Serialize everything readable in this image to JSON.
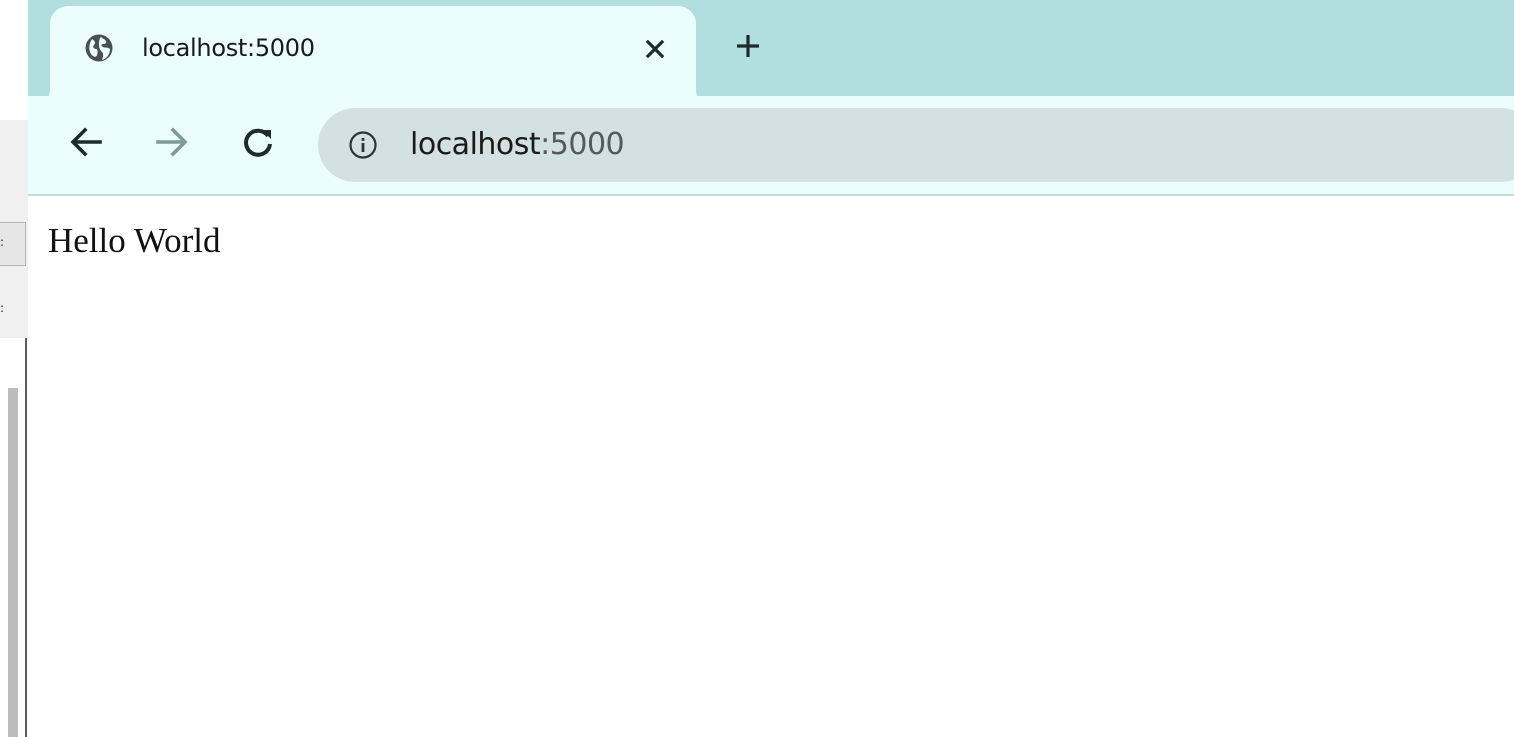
{
  "tab": {
    "title": "localhost:5000",
    "icon": "globe-icon",
    "close_icon": "close-icon"
  },
  "new_tab_icon": "plus-icon",
  "toolbar": {
    "back_icon": "arrow-left-icon",
    "forward_icon": "arrow-right-icon",
    "reload_icon": "reload-icon",
    "info_icon": "info-icon",
    "url_host": "localhost",
    "url_port": ":5000"
  },
  "page": {
    "body_text": "Hello World"
  },
  "colors": {
    "tabstrip": "#b1dfdf",
    "active_tab": "#ecfdfd",
    "omnibox": "#d3e1e1",
    "icon_dark": "#1f2a2a",
    "icon_disabled": "#7e9a9a"
  }
}
